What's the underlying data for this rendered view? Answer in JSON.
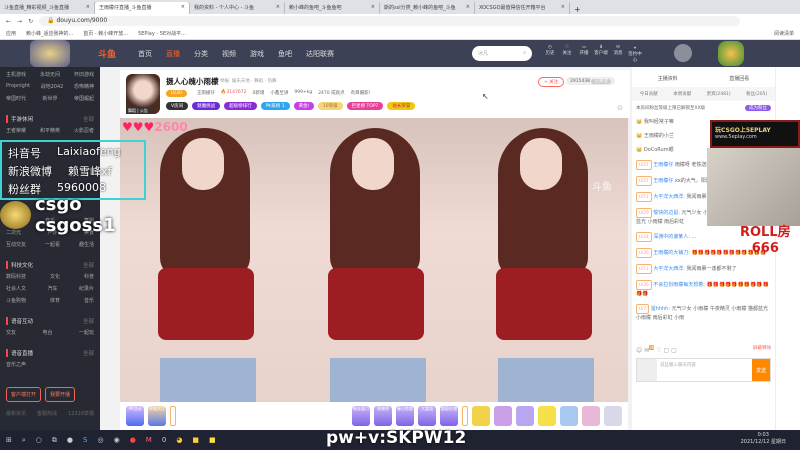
{
  "browser": {
    "tabs": [
      "斗鱼直播_精彩视频_斗鱼直播",
      "王雨檬仔直播_斗鱼直播",
      "我的资料 - 个人中心 - 斗鱼",
      "赖小峰的鱼吧_斗鱼鱼吧",
      "斯的ssl分类_赖小峰的鱼吧_斗鱼",
      "XOCSGO最值得信任开箱平台"
    ],
    "url": "douyu.com/9000",
    "bookmarks": [
      "应用",
      "赖小峰_适应我神的...",
      "首页 - 赖小峰开放...",
      "5EPlay - 5E对战平..."
    ],
    "reading_list": "阅读清单"
  },
  "nav": {
    "links": [
      "首页",
      "直播",
      "分类",
      "视频",
      "游戏",
      "鱼吧",
      "达阳联赛"
    ],
    "search_placeholder": "冰凡",
    "icons": [
      "历史",
      "关注",
      "开播",
      "客户端",
      "消息",
      "签约中心"
    ]
  },
  "sidebar": {
    "rows": [
      [
        "主机游戏",
        "永劫无间",
        "怀旧游戏"
      ],
      [
        "Propnight",
        "战地2042",
        "恐怖精神"
      ],
      [
        "帝国时代",
        "新世界",
        "帝国崛起"
      ]
    ],
    "sections": [
      {
        "title": "手游休闲",
        "more": "全部",
        "rows": [
          [
            "王者荣耀",
            "和平精英",
            "火影忍者"
          ]
        ]
      },
      {
        "title": "",
        "more": "",
        "rows": [
          [
            "颜值",
            "音乐",
            "舞蹈"
          ],
          [
            "二次元",
            "户外",
            "美食"
          ],
          [
            "互动交友",
            "一起看",
            "趣生活"
          ]
        ]
      },
      {
        "title": "科技文化",
        "more": "全部",
        "rows": [
          [
            "数码科技",
            "文化",
            "科普"
          ],
          [
            "社会人文",
            "汽车",
            "纪录片"
          ],
          [
            "斗鱼购物",
            "体育",
            "音乐"
          ]
        ]
      },
      {
        "title": "语音互动",
        "more": "全部",
        "rows": [
          [
            "交友",
            "电台",
            "一起玩"
          ]
        ]
      },
      {
        "title": "语音直播",
        "more": "全部",
        "rows": [
          [
            "音乐之声"
          ]
        ]
      }
    ],
    "buttons": [
      "客户端打开",
      "我要开播"
    ],
    "footer": [
      "最新资讯",
      "客服热线",
      "12318举报"
    ]
  },
  "streamer": {
    "title": "摄人心魄小雨檬",
    "report": "举报",
    "category": "娱乐天地 · 舞蹈 · 热舞",
    "level": "LV30",
    "name": "王雨檬仔",
    "heat": "3147672",
    "followers": "0新增",
    "group": "小鑫至讲",
    "weight": "999+kg",
    "rank": "2470 成就点",
    "notice": "有目摄影！",
    "follow": "+ 关注",
    "fans": "2915438",
    "fans_btn": "已关注",
    "badges": [
      "V房间",
      "魅魔挑战",
      "超级榜排行",
      "PK排榜 1",
      "黄金I",
      "10等级",
      "巨星榜 TOP7",
      "站长荣誉"
    ],
    "avatar_tags": [
      "舞蹈",
      "公告"
    ]
  },
  "overlays": {
    "promo": [
      [
        "抖音号",
        "Laixiaofeng"
      ],
      [
        "新浪微博",
        "赖雪峰xf"
      ],
      [
        "粉丝群",
        "5960008"
      ]
    ],
    "csgo": "csgo csgoss1",
    "ad_title": "玩CSGO上5EPLAY",
    "ad_url": "www.5eplay.com",
    "roll1": "ROLL房",
    "roll2": "666",
    "password": "pw+v:SKPW12",
    "hearts": "2600"
  },
  "gifts": {
    "left": [
      "PK活动",
      "开放大厅"
    ],
    "mid": [
      "粉丝荟口",
      "荣誉榜",
      "春日惊喜",
      "大富翁",
      "超值礼物"
    ]
  },
  "chat": {
    "tabs": [
      "主播资料",
      "直播回看"
    ],
    "rank_tabs": [
      "今日贡献",
      "本周贡献",
      "贵宾(2481)",
      "粉丝(205)"
    ],
    "notice": "本房间粉丝等级上限已解锁至XX级",
    "join": "成为粉丝",
    "top": [
      "我叫经常子嘛",
      "王雨檬的小兰",
      "DoCoRum眼"
    ],
    "messages": [
      {
        "lv": "LV21",
        "name": "王雨檬仔",
        "text": "雨檬呀 老铁送的大气"
      },
      {
        "lv": "LV21",
        "name": "王雨檬仔",
        "text": "xx的大气，阳阳加重啊~"
      },
      {
        "lv": "LV11",
        "name": "大平洋大西洋:",
        "text": "我闻雨裹一逢都不剩了"
      },
      {
        "lv": "LV29",
        "name": "愉快的边鼠:",
        "text": "元气少女 小雨檬 午夜精灵 小雨檬 猫都蓝光 小雨檬 雨后彩虹"
      },
      {
        "lv": "LV34",
        "name": "深渊中的谦某人:",
        "text": "..."
      },
      {
        "lv": "LV36",
        "name": "王雨檬的大铺刀:",
        "text": "🎁🎁🎁🎁🎁🎁🎁🎁🎁🎁🎁🎁"
      },
      {
        "lv": "LV11",
        "name": "大平洋大西洋:",
        "text": "我闻雨裹一逢都不剩了"
      },
      {
        "lv": "LV36",
        "name": "不会拉扮雨檬每天想着:",
        "text": "🎁🎁🎁🎁🎁🎁🎁🎁🎁🎁🎁🎁"
      },
      {
        "lv": "LV7",
        "name": "溜hhhh:",
        "text": "元气少女 小雨檬 午夜精灵 小雨檬 猫都蓝光 小雨檬 雨后彩虹 小雨"
      }
    ],
    "input_placeholder": "说些输入聊天内容",
    "send": "发送",
    "badge_count": "26",
    "shield": "屏蔽特效"
  },
  "taskbar": {
    "time": "0:03",
    "date": "2021/12/12 星期日"
  }
}
